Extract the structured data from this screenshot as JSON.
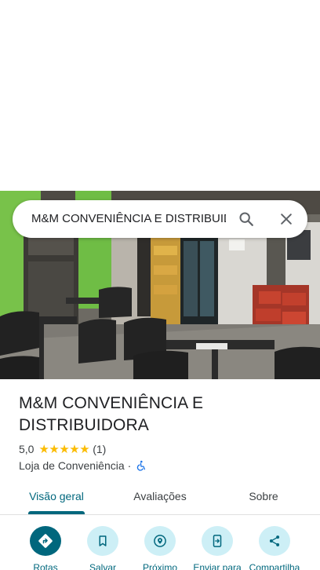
{
  "search": {
    "query": "M&M CONVENIÊNCIA E DISTRIBUIDORA",
    "search_icon": "search-icon",
    "close_icon": "close-icon"
  },
  "place": {
    "name_line1": "M&M CONVENIÊNCIA E",
    "name_line2": "DISTRIBUIDORA",
    "rating": "5,0",
    "stars": "★★★★★",
    "review_count": "(1)",
    "category": "Loja de Conveniência",
    "separator": "·",
    "accessibility_icon": "wheelchair-icon"
  },
  "tabs": [
    {
      "label": "Visão geral",
      "active": true
    },
    {
      "label": "Avaliações",
      "active": false
    },
    {
      "label": "Sobre",
      "active": false
    }
  ],
  "actions": [
    {
      "label": "Rotas",
      "icon": "directions-icon"
    },
    {
      "label": "Salvar",
      "icon": "bookmark-icon"
    },
    {
      "label": "Próximo",
      "icon": "nearby-icon"
    },
    {
      "label": "Enviar para",
      "icon": "send-to-phone-icon"
    },
    {
      "label": "Compartilha",
      "icon": "share-icon"
    }
  ],
  "colors": {
    "accent": "#00677d",
    "accent_light": "#cdeff6",
    "star": "#fbbc04"
  }
}
